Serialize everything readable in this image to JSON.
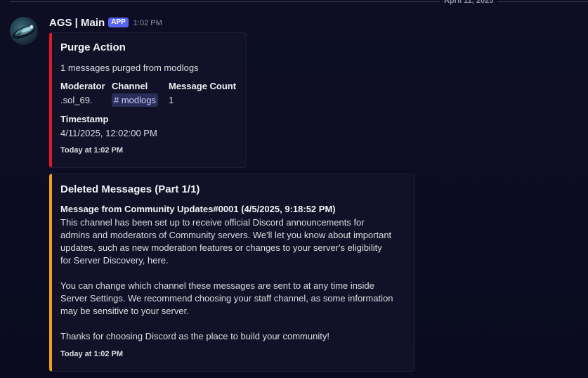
{
  "date_divider": "April 11, 2025",
  "message": {
    "author": "AGS | Main",
    "app_tag": "APP",
    "time": "1:02 PM"
  },
  "embed1": {
    "title": "Purge Action",
    "description": "1 messages purged from modlogs",
    "fields": {
      "moderator_label": "Moderator",
      "moderator_value": ".sol_69.",
      "channel_label": "Channel",
      "channel_value": "# modlogs",
      "count_label": "Message Count",
      "count_value": "1",
      "timestamp_label": "Timestamp",
      "timestamp_value": "4/11/2025, 12:02:00 PM"
    },
    "footer": "Today at 1:02 PM",
    "accent_color": "#e0162b"
  },
  "embed2": {
    "title": "Deleted Messages (Part 1/1)",
    "header_line": "Message from Community Updates#0001 (4/5/2025, 9:18:52 PM)",
    "lines": [
      "This channel has been set up to receive official Discord announcements for",
      "admins and moderators of Community servers. We'll let you know about important",
      "updates, such as new moderation features or changes to your server's eligibility",
      "for Server Discovery, here.",
      "",
      "You can change which channel these messages are sent to at any time inside",
      "Server Settings. We recommend choosing your staff channel, as some information",
      "may be sensitive to your server.",
      "",
      "Thanks for choosing Discord as the place to build your community!"
    ],
    "footer": "Today at 1:02 PM",
    "accent_color": "#f0a217"
  },
  "colors": {
    "background": "#0c0d22",
    "app_tag": "#5865f2",
    "mention_bg": "#2a2d5a"
  }
}
